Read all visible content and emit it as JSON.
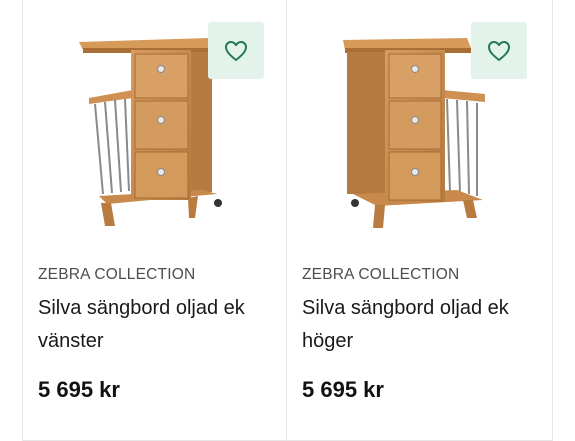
{
  "products": [
    {
      "brand": "ZEBRA COLLECTION",
      "title": "Silva sängbord oljad ek vänster",
      "price": "5 695 kr",
      "favorite_icon": "heart-outline-icon",
      "image": "bedside-table-left-image"
    },
    {
      "brand": "ZEBRA COLLECTION",
      "title": "Silva sängbord oljad ek höger",
      "price": "5 695 kr",
      "favorite_icon": "heart-outline-icon",
      "image": "bedside-table-right-image"
    }
  ],
  "colors": {
    "favorite_bg": "#e4f2ec",
    "favorite_icon": "#1f7a55",
    "oak": "#c98a4a"
  }
}
